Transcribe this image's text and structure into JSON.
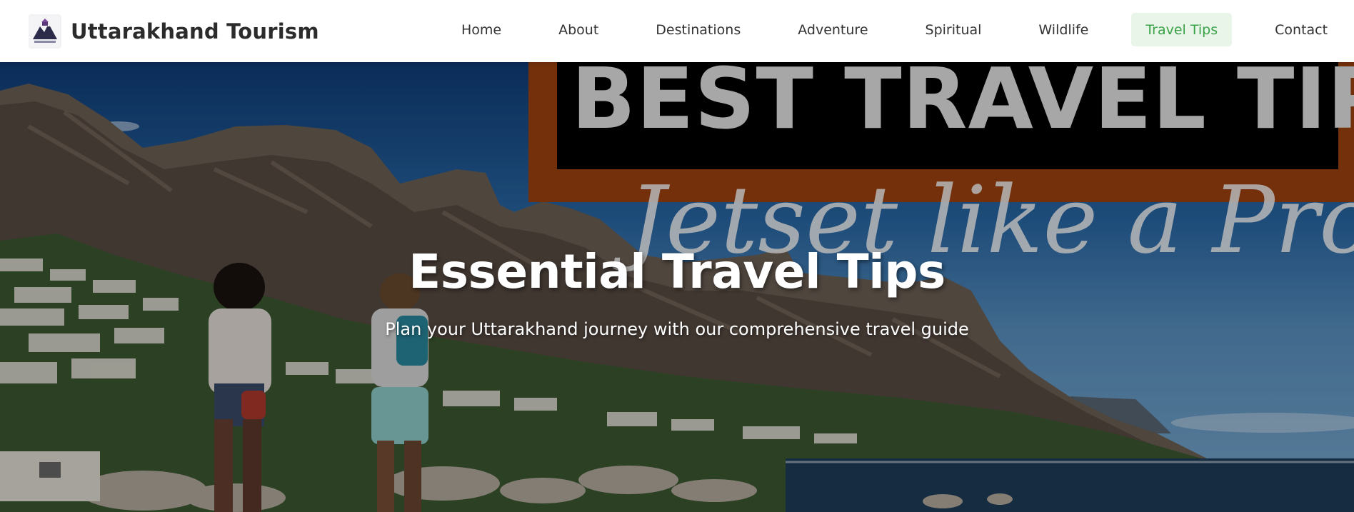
{
  "brand": {
    "name": "Uttarakhand Tourism",
    "logo_icon": "mountain-temple-logo"
  },
  "nav": {
    "items": [
      {
        "label": "Home",
        "active": false
      },
      {
        "label": "About",
        "active": false
      },
      {
        "label": "Destinations",
        "active": false
      },
      {
        "label": "Adventure",
        "active": false
      },
      {
        "label": "Spiritual",
        "active": false
      },
      {
        "label": "Wildlife",
        "active": false
      },
      {
        "label": "Travel Tips",
        "active": true
      },
      {
        "label": "Contact",
        "active": false
      }
    ],
    "active_color": "#3aa348",
    "active_bg": "#eaf5ea"
  },
  "hero": {
    "title": "Essential Travel Tips",
    "subtitle": "Plan your Uttarakhand journey with our comprehensive travel guide",
    "image_banner": {
      "headline": "BEST TRAVEL TIPS",
      "tagline": "Jetset like a Pro"
    }
  }
}
